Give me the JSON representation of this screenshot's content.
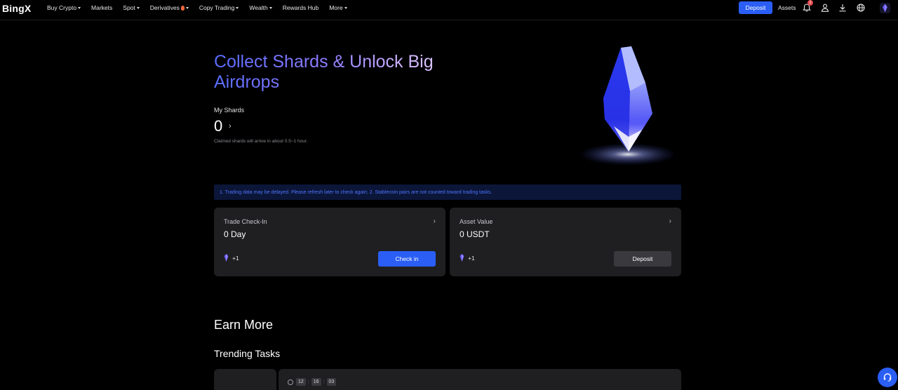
{
  "nav": {
    "logo": "BingX",
    "items": [
      {
        "label": "Buy Crypto",
        "caret": true
      },
      {
        "label": "Markets",
        "caret": false
      },
      {
        "label": "Spot",
        "caret": true
      },
      {
        "label": "Derivatives",
        "caret": true,
        "flame": true
      },
      {
        "label": "Copy Trading",
        "caret": true
      },
      {
        "label": "Wealth",
        "caret": true
      },
      {
        "label": "Rewards Hub",
        "caret": false
      },
      {
        "label": "More",
        "caret": true
      }
    ],
    "deposit_label": "Deposit",
    "assets_label": "Assets",
    "notification_count": "2",
    "icons": [
      "bell-icon",
      "user-icon",
      "download-icon",
      "globe-icon",
      "avatar"
    ]
  },
  "hero": {
    "title": "Collect Shards & Unlock Big Airdrops",
    "my_shards_label": "My Shards",
    "shards_value": "0",
    "claim_note": "Claimed shards will arrive in about 0.5~1 hour."
  },
  "notice": "1. Trading data may be delayed. Please refresh later to check again; 2. Stablecoin pairs are not counted toward trading tasks.",
  "cards": [
    {
      "title": "Trade Check-In",
      "value": "0 Day",
      "reward": "+1",
      "button": "Check in",
      "style": "primary"
    },
    {
      "title": "Asset Value",
      "value": "0 USDT",
      "reward": "+1",
      "button": "Deposit",
      "style": "secondary"
    }
  ],
  "earn_more": {
    "title": "Earn More",
    "trending_title": "Trending Tasks",
    "timer": {
      "hours": "12",
      "minutes": "16",
      "seconds": "03"
    }
  },
  "colors": {
    "accent": "#2a5ef5",
    "background": "#000000",
    "card": "#1f1f22",
    "notice_bg": "#0b1638",
    "notice_text": "#4f74ff"
  }
}
